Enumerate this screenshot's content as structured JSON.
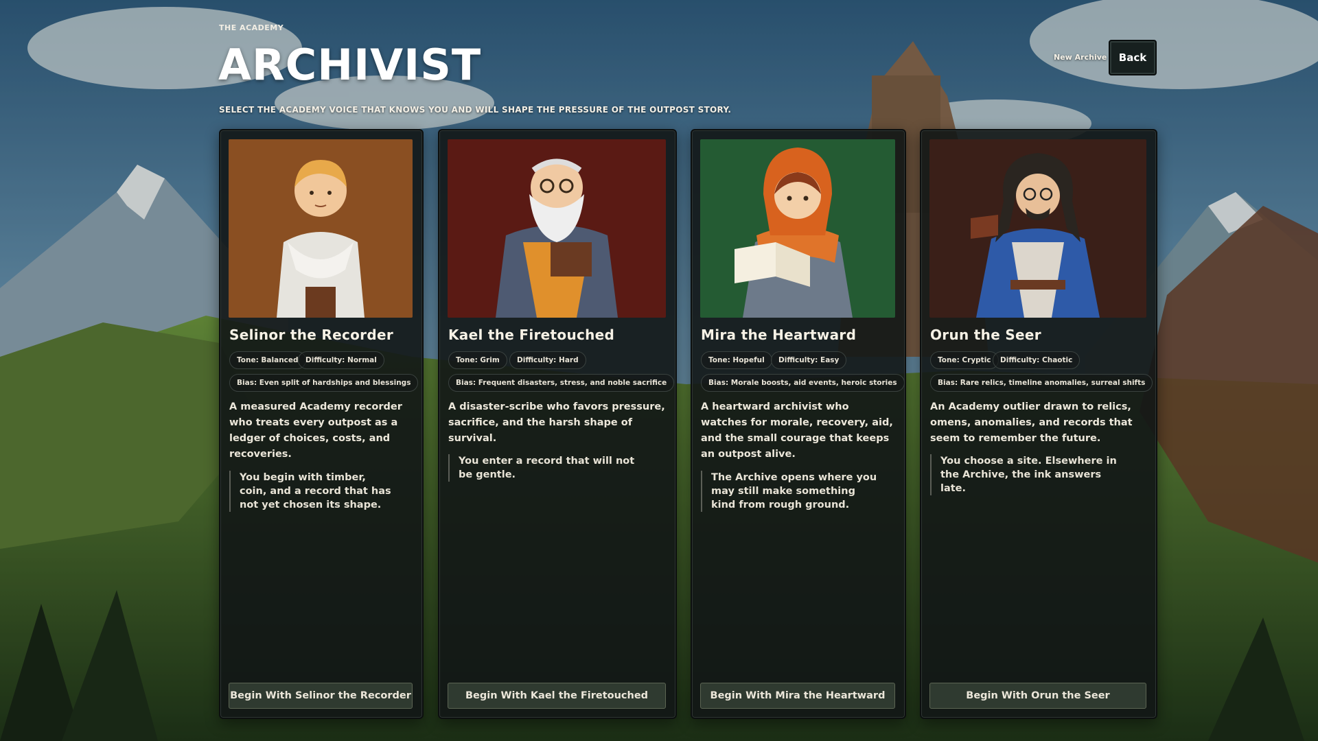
{
  "header": {
    "eyebrow": "THE ACADEMY",
    "title": "ARCHIVIST",
    "subtitle": "SELECT THE ACADEMY VOICE THAT KNOWS YOU AND WILL SHAPE THE PRESSURE OF THE OUTPOST STORY.",
    "archive_label": "New Archive",
    "back_label": "Back"
  },
  "archivists": [
    {
      "name": "Selinor the Recorder",
      "tone": "Tone: Balanced",
      "difficulty": "Difficulty: Normal",
      "bias": "Bias: Even split of hardships and blessings",
      "description": "A measured Academy recorder who treats every outpost as a ledger of choices, costs, and recoveries.",
      "quote": "You begin with timber, coin, and a record that has not yet chosen its shape.",
      "button": "Begin With Selinor the Recorder",
      "portrait_bg": "#8a4f22",
      "portrait_icon": "blond-recorder-portrait"
    },
    {
      "name": "Kael the Firetouched",
      "tone": "Tone: Grim",
      "difficulty": "Difficulty: Hard",
      "bias": "Bias: Frequent disasters, stress, and noble sacrifice",
      "description": "A disaster-scribe who favors pressure, sacrifice, and the harsh shape of survival.",
      "quote": "You enter a record that will not be gentle.",
      "button": "Begin With Kael the Firetouched",
      "portrait_bg": "#5a1a14",
      "portrait_icon": "bearded-elder-portrait"
    },
    {
      "name": "Mira the Heartward",
      "tone": "Tone: Hopeful",
      "difficulty": "Difficulty: Easy",
      "bias": "Bias: Morale boosts, aid events, heroic stories",
      "description": "A heartward archivist who watches for morale, recovery, aid, and the small courage that keeps an outpost alive.",
      "quote": "The Archive opens where you may still make something kind from rough ground.",
      "button": "Begin With Mira the Heartward",
      "portrait_bg": "#245b33",
      "portrait_icon": "hooded-reader-portrait"
    },
    {
      "name": "Orun the Seer",
      "tone": "Tone: Cryptic",
      "difficulty": "Difficulty: Chaotic",
      "bias": "Bias: Rare relics, timeline anomalies, surreal shifts",
      "description": "An Academy outlier drawn to relics, omens, anomalies, and records that seem to remember the future.",
      "quote": "You choose a site. Elsewhere in the Archive, the ink answers late.",
      "button": "Begin With Orun the Seer",
      "portrait_bg": "#3a1f18",
      "portrait_icon": "robed-seer-portrait"
    }
  ]
}
